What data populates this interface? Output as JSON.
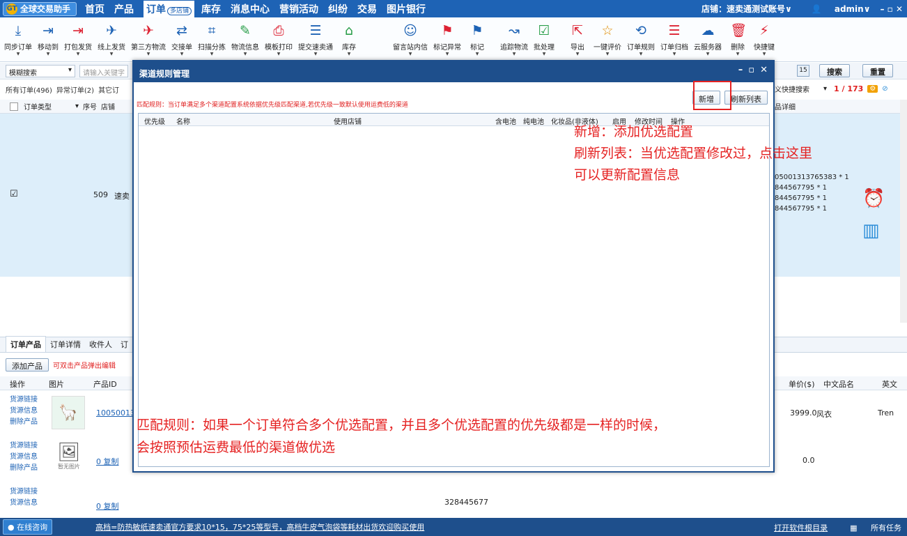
{
  "topbar": {
    "app_name": "全球交易助手",
    "menu": [
      "首页",
      "产品",
      "订单",
      "库存",
      "消息中心",
      "营销活动",
      "纠纷",
      "交易",
      "图片银行"
    ],
    "order_badge": "多店铺",
    "store_label": "店铺：速卖通测试账号∨",
    "user": "admin∨",
    "window_controls": "– ▫ ✕"
  },
  "toolbar": {
    "items": [
      {
        "label": "同步订单",
        "icon": "download-icon"
      },
      {
        "label": "移动到",
        "icon": "move-icon"
      },
      {
        "label": "打包发货",
        "icon": "pack-ship-icon"
      },
      {
        "label": "线上发货",
        "icon": "online-ship-icon"
      },
      {
        "label": "第三方物流",
        "icon": "third-party-icon"
      },
      {
        "label": "交接单",
        "icon": "handover-icon"
      },
      {
        "label": "扫描分拣",
        "icon": "scan-icon"
      },
      {
        "label": "物流信息",
        "icon": "pen-icon"
      },
      {
        "label": "模板打印",
        "icon": "print-icon"
      },
      {
        "label": "提交速卖通",
        "icon": "submit-icon"
      },
      {
        "label": "库存",
        "icon": "warehouse-icon"
      },
      {
        "label": "留言站内信",
        "icon": "message-icon"
      },
      {
        "label": "标记异常",
        "icon": "flag-icon"
      },
      {
        "label": "标记",
        "icon": "flag-blue-icon"
      },
      {
        "label": "追踪物流",
        "icon": "track-icon"
      },
      {
        "label": "批处理",
        "icon": "batch-icon"
      },
      {
        "label": "导出",
        "icon": "export-icon"
      },
      {
        "label": "一键评价",
        "icon": "review-icon"
      },
      {
        "label": "订单规则",
        "icon": "rule-icon"
      },
      {
        "label": "订单归档",
        "icon": "archive-icon"
      },
      {
        "label": "云服务器",
        "icon": "cloud-icon"
      },
      {
        "label": "删除",
        "icon": "trash-icon"
      },
      {
        "label": "快捷键",
        "icon": "lightning-icon"
      }
    ]
  },
  "search": {
    "mode": "模糊搜索",
    "placeholder": "请输入关键字",
    "date_icon": "15",
    "search_btn": "搜索",
    "reset_btn": "重置",
    "quick_search": "义快捷搜索",
    "page": "1 / 173"
  },
  "tabs": {
    "all": "所有订单(496)",
    "abnormal": "异常订单(2)",
    "other": "其它订"
  },
  "list": {
    "col_type": "订单类型",
    "col_seq": "序号",
    "col_store": "店铺",
    "col_detail": "品详细",
    "row_check": "☑",
    "row_seq": "509",
    "row_store": "速卖",
    "detail_lines": [
      "05001313765383  * 1",
      "844567795  * 1",
      "844567795  * 1",
      "844567795  * 1"
    ]
  },
  "bottom": {
    "tabs": [
      "订单产品",
      "订单详情",
      "收件人",
      "订"
    ],
    "add_btn": "添加产品",
    "hint": "可双击产品弹出编辑",
    "cols": {
      "op": "操作",
      "img": "图片",
      "pid": "产品ID",
      "price": "单价($)",
      "cn": "中文品名",
      "en": "英文"
    },
    "rows": [
      {
        "links": [
          "货源链接",
          "货源信息",
          "删除产品"
        ],
        "pid": "10050013",
        "price": "3999.0",
        "cn": "风衣",
        "en": "Tren"
      },
      {
        "links": [
          "货源链接",
          "货源信息",
          "删除产品"
        ],
        "pid": "0 复制",
        "noimg": "暂无图片",
        "price": "0.0"
      },
      {
        "links": [
          "货源链接",
          "货源信息"
        ],
        "pid": "0 复制",
        "extra": "328445677"
      }
    ]
  },
  "status": {
    "online": "在线咨询",
    "marquee": "高档=防热敏纸速卖通官方要求10*15，75*25等型号，高档牛皮气泡袋等耗材出货欢迎购买使用",
    "open_dir": "打开软件根目录",
    "tasks": "所有任务"
  },
  "dialog": {
    "title": "渠道规则管理",
    "rule": "匹配规则：当订单满足多个渠道配置系统依据优先级匹配渠道,若优先级一致默认使用运费低的渠道",
    "add_btn": "新增",
    "refresh_btn": "刷新列表",
    "cols": [
      "优先级",
      "名称",
      "使用店铺",
      "含电池",
      "纯电池",
      "化妆品(非液体)",
      "启用",
      "修改时间",
      "操作"
    ]
  },
  "annotations": {
    "add": "新增：添加优选配置",
    "refresh1": "刷新列表：当优选配置修改过，点击这里",
    "refresh2": "可以更新配置信息",
    "match1": "匹配规则：如果一个订单符合多个优选配置，并且多个优选配置的优先级都是一样的时候，",
    "match2": "会按照预估运费最低的渠道做优选"
  },
  "colors": {
    "primary": "#1e63b5",
    "dialog_bar": "#1e4f8c",
    "annotation": "#e52222"
  }
}
